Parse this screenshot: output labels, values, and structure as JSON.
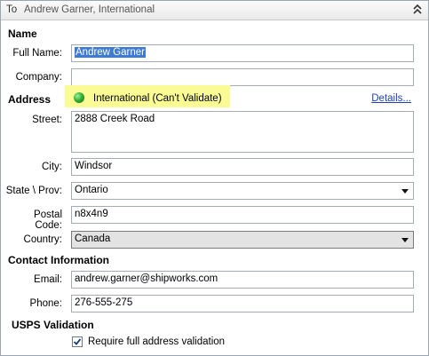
{
  "header": {
    "to_label": "To",
    "recipient_summary": "Andrew Garner, International"
  },
  "name_section": {
    "title": "Name",
    "full_name_label": "Full Name:",
    "full_name_value": "Andrew Garner",
    "company_label": "Company:",
    "company_value": ""
  },
  "address_section": {
    "title": "Address",
    "status_icon": "green-globe-icon",
    "status_text": "International (Can't Validate)",
    "details_link": "Details...",
    "street_label": "Street:",
    "street_value": "2888 Creek Road",
    "city_label": "City:",
    "city_value": "Windsor",
    "state_label": "State \\ Prov:",
    "state_value": "Ontario",
    "postal_label": "Postal Code:",
    "postal_value": "n8x4n9",
    "country_label": "Country:",
    "country_value": "Canada"
  },
  "contact_section": {
    "title": "Contact Information",
    "email_label": "Email:",
    "email_value": "andrew.garner@shipworks.com",
    "phone_label": "Phone:",
    "phone_value": "276-555-275"
  },
  "usps_section": {
    "title": "USPS Validation",
    "require_label": "Require full address validation",
    "require_checked": true
  },
  "colors": {
    "highlight": "#fbfb95",
    "link": "#1a3fcf",
    "selection": "#3d7bd4"
  }
}
